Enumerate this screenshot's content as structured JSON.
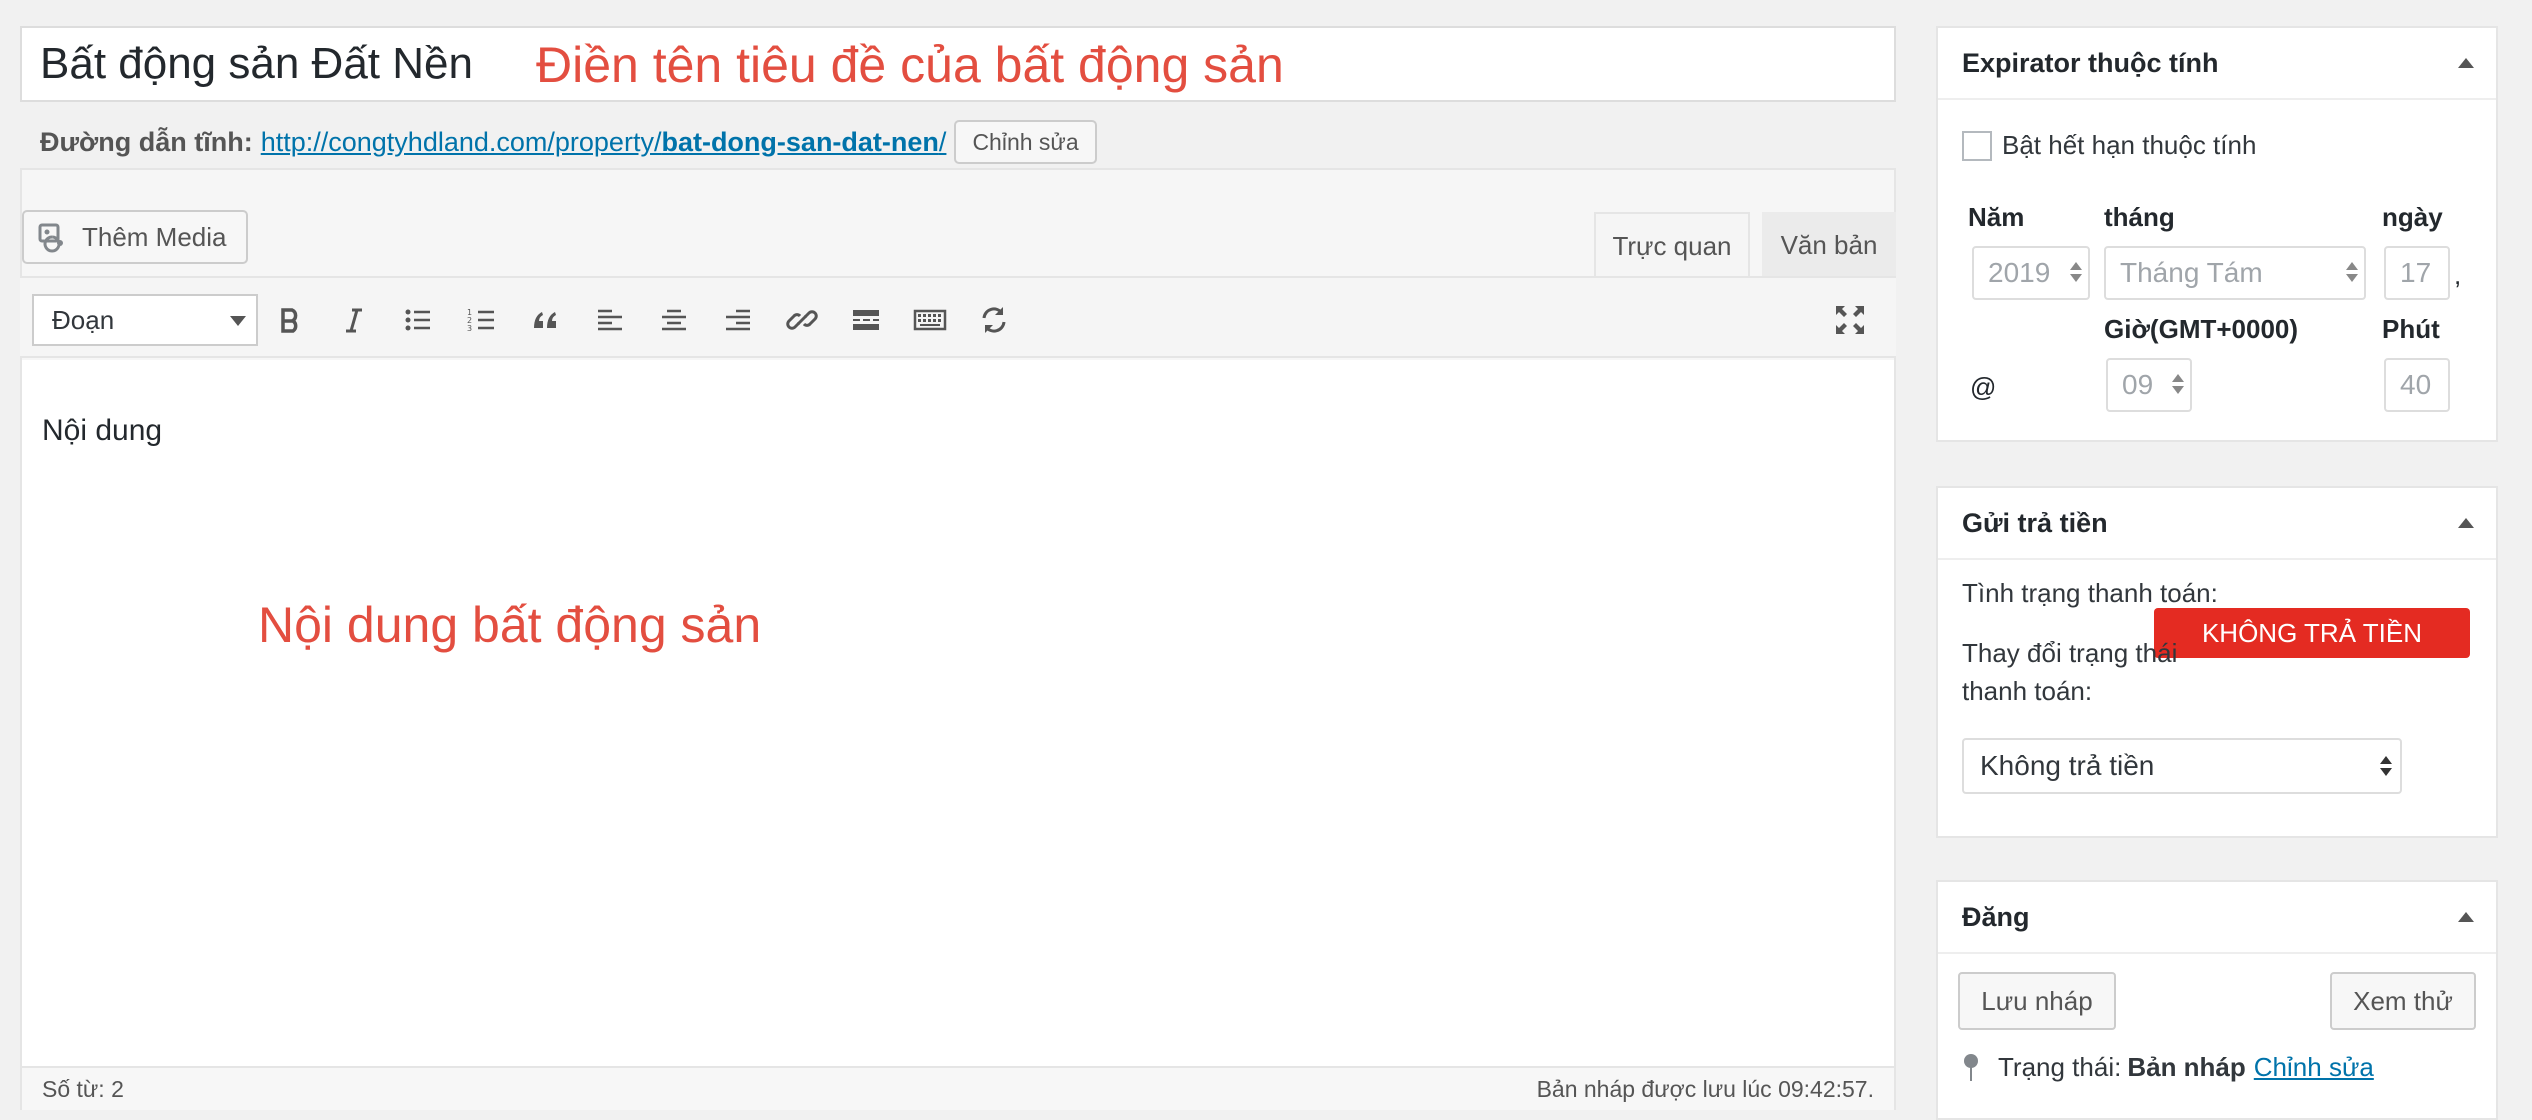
{
  "title": {
    "value": "Bất động sản Đất Nền",
    "hint": "Điền tên tiêu đề của bất động sản"
  },
  "permalink": {
    "label": "Đường dẫn tĩnh:",
    "url_base": "http://congtyhdland.com/property/",
    "slug": "bat-dong-san-dat-nen",
    "trailing": "/",
    "edit_button": "Chỉnh sửa"
  },
  "editor": {
    "add_media": "Thêm Media",
    "tabs": {
      "visual": "Trực quan",
      "text": "Văn bản"
    },
    "format_select": "Đoạn",
    "content": "Nội dung",
    "content_hint": "Nội dung bất động sản",
    "word_count": "Số từ: 2",
    "draft_saved": "Bản nháp được lưu lúc 09:42:57."
  },
  "expirator": {
    "title": "Expirator thuộc tính",
    "checkbox_label": "Bật hết hạn thuộc tính",
    "year_label": "Năm",
    "month_label": "tháng",
    "day_label": "ngày",
    "year": "2019",
    "month": "Tháng Tám",
    "day": "17",
    "comma": ",",
    "at": "@",
    "hour_label": "Giờ(GMT+0000)",
    "minute_label": "Phút",
    "hour": "09",
    "minute": "40"
  },
  "payment": {
    "title": "Gửi trả tiền",
    "status_label": "Tình trạng thanh toán:",
    "status_badge": "KHÔNG TRẢ TIỀN",
    "status_badge_color": "#e42b22",
    "change_label": "Thay đổi trạng thái thanh toán:",
    "select_value": "Không trả tiền"
  },
  "publish": {
    "title": "Đăng",
    "save_draft": "Lưu nháp",
    "preview": "Xem thử",
    "status_label": "Trạng thái:",
    "status_value": "Bản nháp",
    "status_edit": "Chỉnh sửa"
  },
  "colors": {
    "link": "#0073aa",
    "hint": "#e34e40"
  }
}
